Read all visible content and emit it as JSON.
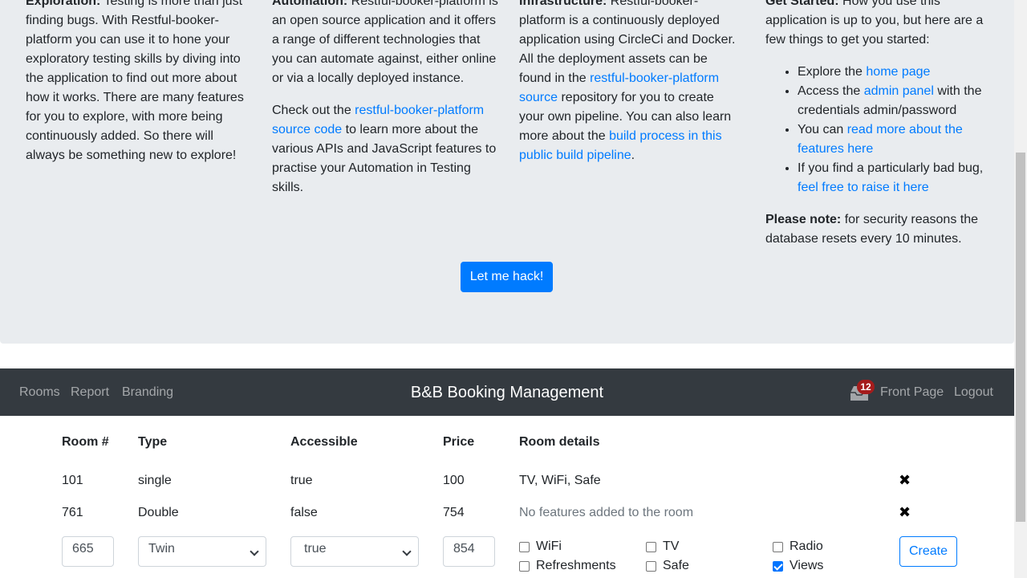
{
  "intro": {
    "exploration": {
      "title": "Exploration:",
      "text": " Testing is more than just finding bugs. With Restful-booker-platform you can use it to hone your exploratory testing skills by diving into the application to find out more about how it works. There are many features for you to explore, with more being continuously added. So there will always be something new to explore!"
    },
    "automation": {
      "title": "Automation:",
      "text": " Restful-booker-platform is an open source application and it offers a range of different technologies that you can automate against, either online or via a locally deployed instance.",
      "p2_pre": "Check out the ",
      "p2_link": "restful-booker-platform source code",
      "p2_post": " to learn more about the various APIs and JavaScript features to practise your Automation in Testing skills."
    },
    "infrastructure": {
      "title": "Infrastructure:",
      "text_pre": " Restful-booker-platform is a continuously deployed application using CircleCi and Docker. All the deployment assets can be found in the ",
      "link1": "restful-booker-platform source",
      "text_mid": " repository for you to create your own pipeline. You can also learn more about the ",
      "link2": "build process in this public build pipeline",
      "text_post": "."
    },
    "get_started": {
      "title": "Get Started:",
      "text": " How you use this application is up to you, but here are a few things to get you started:",
      "li1_pre": "Explore the ",
      "li1_link": "home page",
      "li2_pre": "Access the ",
      "li2_link": "admin panel",
      "li2_post": " with the credentials admin/password",
      "li3_pre": "You can ",
      "li3_link": "read more about the features here",
      "li4_pre": "If you find a particularly bad bug, ",
      "li4_link": "feel free to raise it here",
      "note_title": "Please note:",
      "note_text": " for security reasons the database resets every 10 minutes."
    },
    "hack_button": "Let me hack!"
  },
  "navbar": {
    "links": [
      "Rooms",
      "Report",
      "Branding"
    ],
    "brand": "B&B Booking Management",
    "notification_count": "12",
    "front_page": "Front Page",
    "logout": "Logout"
  },
  "table": {
    "headers": [
      "Room #",
      "Type",
      "Accessible",
      "Price",
      "Room details"
    ],
    "rows": [
      {
        "room": "101",
        "type": "single",
        "accessible": "true",
        "price": "100",
        "details": "TV, WiFi, Safe"
      },
      {
        "room": "761",
        "type": "Double",
        "accessible": "false",
        "price": "754",
        "details": "No features added to the room"
      }
    ],
    "delete_icon": "close-icon"
  },
  "form": {
    "room_value": "665",
    "type_value": "Twin",
    "accessible_value": "true",
    "price_value": "854",
    "features": [
      {
        "label": "WiFi",
        "checked": false
      },
      {
        "label": "TV",
        "checked": false
      },
      {
        "label": "Radio",
        "checked": false
      },
      {
        "label": "Refreshments",
        "checked": false
      },
      {
        "label": "Safe",
        "checked": false
      },
      {
        "label": "Views",
        "checked": true
      }
    ],
    "create_label": "Create"
  },
  "colors": {
    "primary": "#007bff",
    "navbar": "#343a40",
    "jumbotron": "#e9ecef",
    "badge": "#a51c1c"
  }
}
